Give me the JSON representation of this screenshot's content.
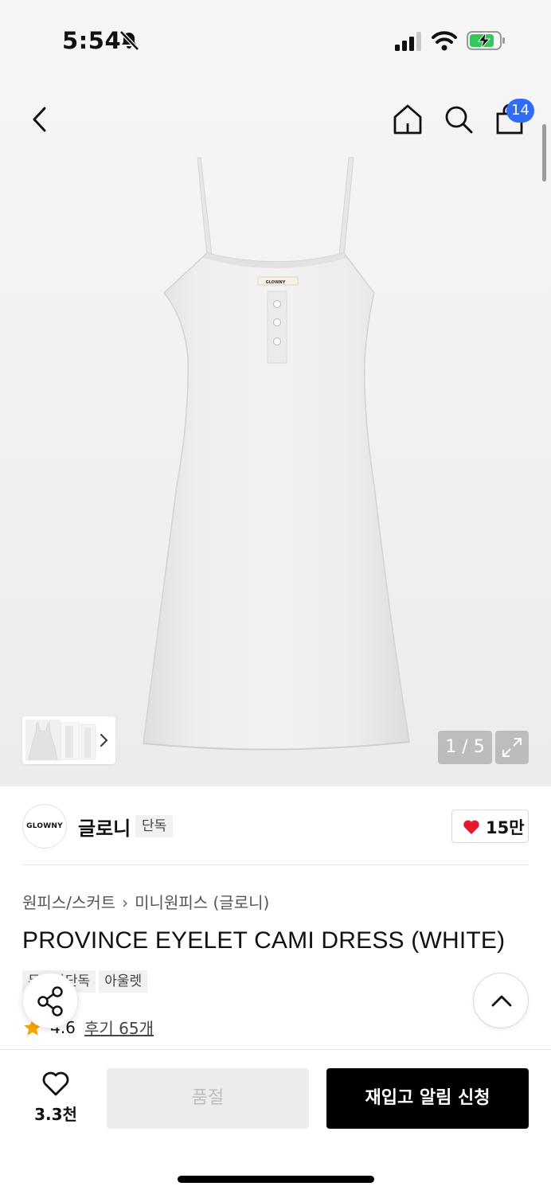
{
  "status_bar": {
    "time": "5:54"
  },
  "header": {
    "cart_count": "14"
  },
  "gallery": {
    "page_indicator": "1 / 5",
    "label_text": "GLOWNY"
  },
  "brand": {
    "logo_text": "GLOWNY",
    "name": "글로니",
    "tag": "단독",
    "like_count": "15만"
  },
  "product": {
    "breadcrumb": [
      "원피스/스커트",
      "미니원피스 (글로니)"
    ],
    "title": "PROVINCE EYELET CAMI DRESS (WHITE)",
    "tags": [
      "무신사단독",
      "아울렛"
    ],
    "rating": "4.6",
    "reviews_label": "후기 65개"
  },
  "bottom_bar": {
    "wish_count": "3.3천",
    "soldout_label": "품절",
    "restock_label": "재입고 알림 신청"
  },
  "colors": {
    "accent_blue": "#2f6df6",
    "heart_red": "#e8192c",
    "star_orange": "#f5a300"
  }
}
